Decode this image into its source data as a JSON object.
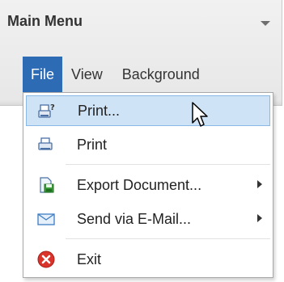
{
  "main_menu": {
    "title": "Main Menu",
    "tabs": [
      {
        "label": "File",
        "active": true
      },
      {
        "label": "View",
        "active": false
      },
      {
        "label": "Background",
        "active": false
      }
    ]
  },
  "dropdown": {
    "items": [
      {
        "label": "Print...",
        "icon": "print-preview-icon",
        "highlighted": true,
        "submenu": false
      },
      {
        "label": "Print",
        "icon": "printer-icon",
        "highlighted": false,
        "submenu": false
      },
      {
        "label": "Export Document...",
        "icon": "export-document-icon",
        "highlighted": false,
        "submenu": true
      },
      {
        "label": "Send via E-Mail...",
        "icon": "envelope-icon",
        "highlighted": false,
        "submenu": true
      },
      {
        "label": "Exit",
        "icon": "exit-icon",
        "highlighted": false,
        "submenu": false
      }
    ]
  },
  "colors": {
    "accent": "#2d6cb5",
    "hover_background": "#cfe3f7",
    "hover_border": "#88b8e6"
  }
}
